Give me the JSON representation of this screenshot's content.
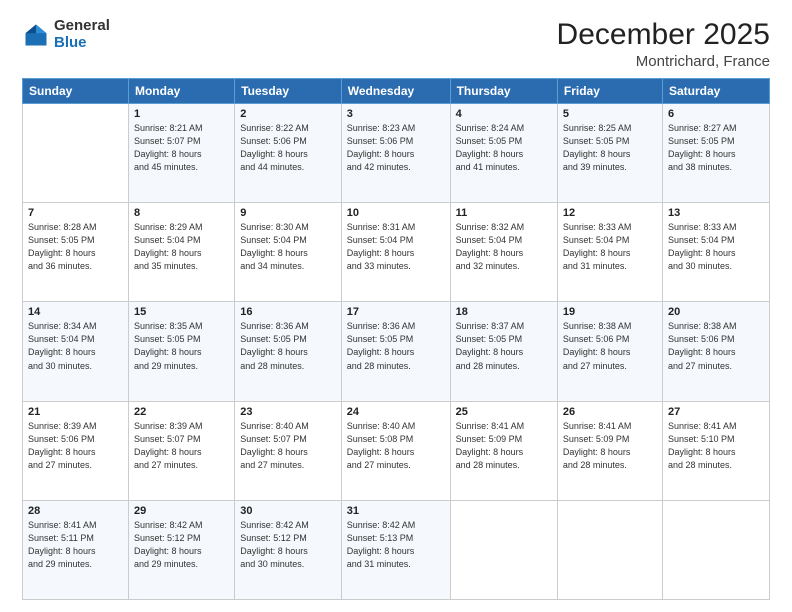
{
  "logo": {
    "general": "General",
    "blue": "Blue"
  },
  "header": {
    "month": "December 2025",
    "location": "Montrichard, France"
  },
  "weekdays": [
    "Sunday",
    "Monday",
    "Tuesday",
    "Wednesday",
    "Thursday",
    "Friday",
    "Saturday"
  ],
  "weeks": [
    [
      {
        "day": "",
        "info": ""
      },
      {
        "day": "1",
        "info": "Sunrise: 8:21 AM\nSunset: 5:07 PM\nDaylight: 8 hours\nand 45 minutes."
      },
      {
        "day": "2",
        "info": "Sunrise: 8:22 AM\nSunset: 5:06 PM\nDaylight: 8 hours\nand 44 minutes."
      },
      {
        "day": "3",
        "info": "Sunrise: 8:23 AM\nSunset: 5:06 PM\nDaylight: 8 hours\nand 42 minutes."
      },
      {
        "day": "4",
        "info": "Sunrise: 8:24 AM\nSunset: 5:05 PM\nDaylight: 8 hours\nand 41 minutes."
      },
      {
        "day": "5",
        "info": "Sunrise: 8:25 AM\nSunset: 5:05 PM\nDaylight: 8 hours\nand 39 minutes."
      },
      {
        "day": "6",
        "info": "Sunrise: 8:27 AM\nSunset: 5:05 PM\nDaylight: 8 hours\nand 38 minutes."
      }
    ],
    [
      {
        "day": "7",
        "info": "Sunrise: 8:28 AM\nSunset: 5:05 PM\nDaylight: 8 hours\nand 36 minutes."
      },
      {
        "day": "8",
        "info": "Sunrise: 8:29 AM\nSunset: 5:04 PM\nDaylight: 8 hours\nand 35 minutes."
      },
      {
        "day": "9",
        "info": "Sunrise: 8:30 AM\nSunset: 5:04 PM\nDaylight: 8 hours\nand 34 minutes."
      },
      {
        "day": "10",
        "info": "Sunrise: 8:31 AM\nSunset: 5:04 PM\nDaylight: 8 hours\nand 33 minutes."
      },
      {
        "day": "11",
        "info": "Sunrise: 8:32 AM\nSunset: 5:04 PM\nDaylight: 8 hours\nand 32 minutes."
      },
      {
        "day": "12",
        "info": "Sunrise: 8:33 AM\nSunset: 5:04 PM\nDaylight: 8 hours\nand 31 minutes."
      },
      {
        "day": "13",
        "info": "Sunrise: 8:33 AM\nSunset: 5:04 PM\nDaylight: 8 hours\nand 30 minutes."
      }
    ],
    [
      {
        "day": "14",
        "info": "Sunrise: 8:34 AM\nSunset: 5:04 PM\nDaylight: 8 hours\nand 30 minutes."
      },
      {
        "day": "15",
        "info": "Sunrise: 8:35 AM\nSunset: 5:05 PM\nDaylight: 8 hours\nand 29 minutes."
      },
      {
        "day": "16",
        "info": "Sunrise: 8:36 AM\nSunset: 5:05 PM\nDaylight: 8 hours\nand 28 minutes."
      },
      {
        "day": "17",
        "info": "Sunrise: 8:36 AM\nSunset: 5:05 PM\nDaylight: 8 hours\nand 28 minutes."
      },
      {
        "day": "18",
        "info": "Sunrise: 8:37 AM\nSunset: 5:05 PM\nDaylight: 8 hours\nand 28 minutes."
      },
      {
        "day": "19",
        "info": "Sunrise: 8:38 AM\nSunset: 5:06 PM\nDaylight: 8 hours\nand 27 minutes."
      },
      {
        "day": "20",
        "info": "Sunrise: 8:38 AM\nSunset: 5:06 PM\nDaylight: 8 hours\nand 27 minutes."
      }
    ],
    [
      {
        "day": "21",
        "info": "Sunrise: 8:39 AM\nSunset: 5:06 PM\nDaylight: 8 hours\nand 27 minutes."
      },
      {
        "day": "22",
        "info": "Sunrise: 8:39 AM\nSunset: 5:07 PM\nDaylight: 8 hours\nand 27 minutes."
      },
      {
        "day": "23",
        "info": "Sunrise: 8:40 AM\nSunset: 5:07 PM\nDaylight: 8 hours\nand 27 minutes."
      },
      {
        "day": "24",
        "info": "Sunrise: 8:40 AM\nSunset: 5:08 PM\nDaylight: 8 hours\nand 27 minutes."
      },
      {
        "day": "25",
        "info": "Sunrise: 8:41 AM\nSunset: 5:09 PM\nDaylight: 8 hours\nand 28 minutes."
      },
      {
        "day": "26",
        "info": "Sunrise: 8:41 AM\nSunset: 5:09 PM\nDaylight: 8 hours\nand 28 minutes."
      },
      {
        "day": "27",
        "info": "Sunrise: 8:41 AM\nSunset: 5:10 PM\nDaylight: 8 hours\nand 28 minutes."
      }
    ],
    [
      {
        "day": "28",
        "info": "Sunrise: 8:41 AM\nSunset: 5:11 PM\nDaylight: 8 hours\nand 29 minutes."
      },
      {
        "day": "29",
        "info": "Sunrise: 8:42 AM\nSunset: 5:12 PM\nDaylight: 8 hours\nand 29 minutes."
      },
      {
        "day": "30",
        "info": "Sunrise: 8:42 AM\nSunset: 5:12 PM\nDaylight: 8 hours\nand 30 minutes."
      },
      {
        "day": "31",
        "info": "Sunrise: 8:42 AM\nSunset: 5:13 PM\nDaylight: 8 hours\nand 31 minutes."
      },
      {
        "day": "",
        "info": ""
      },
      {
        "day": "",
        "info": ""
      },
      {
        "day": "",
        "info": ""
      }
    ]
  ]
}
